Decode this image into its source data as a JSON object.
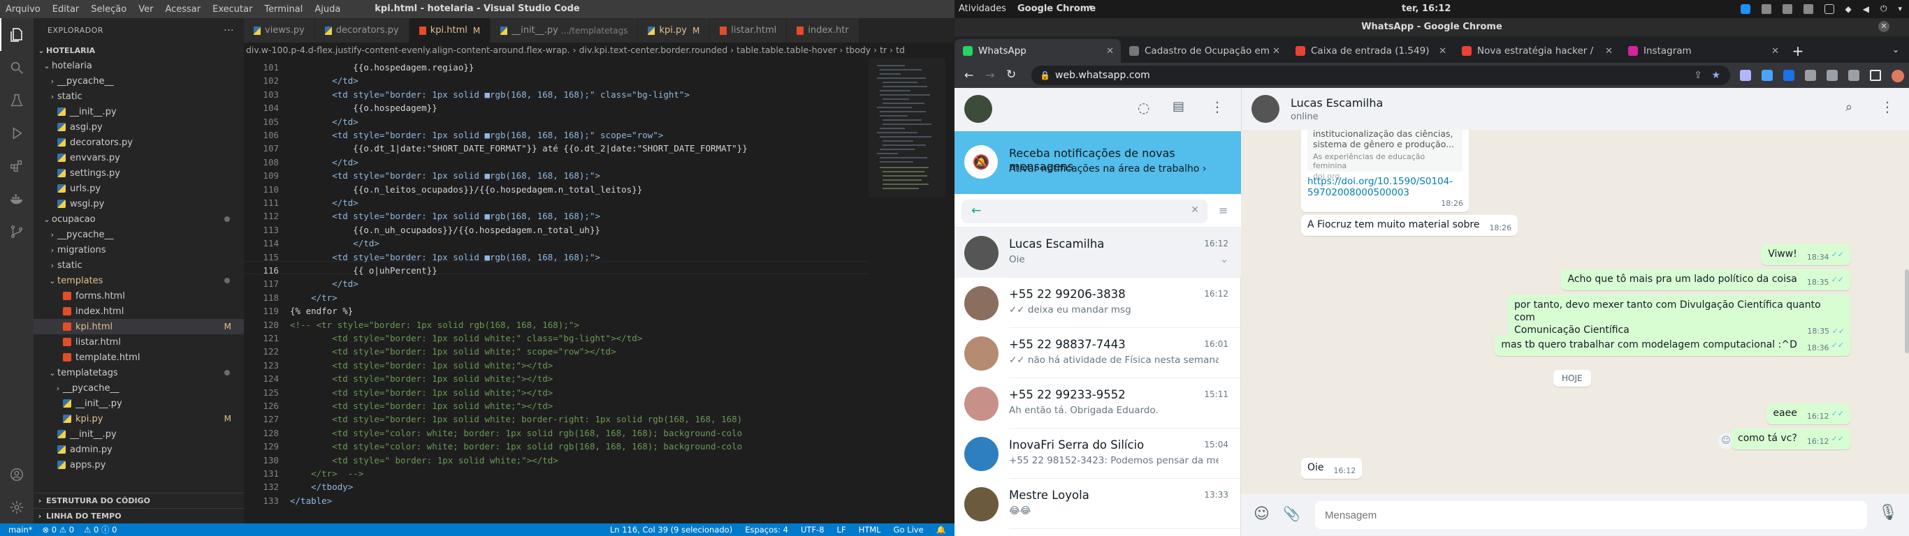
{
  "vscode": {
    "window_title": "kpi.html - hotelaria - Visual Studio Code",
    "menu": [
      "Arquivo",
      "Editar",
      "Seleção",
      "Ver",
      "Acessar",
      "Executar",
      "Terminal",
      "Ajuda"
    ],
    "explorer_title": "EXPLORADOR",
    "project": "HOTELARIA",
    "tree": [
      {
        "label": "hotelaria",
        "chev": "⌄",
        "kind": "folder",
        "indent": 1
      },
      {
        "label": "__pycache__",
        "chev": "›",
        "kind": "folder",
        "indent": 2
      },
      {
        "label": "static",
        "chev": "›",
        "kind": "folder",
        "indent": 2
      },
      {
        "label": "__init__.py",
        "kind": "py",
        "indent": 2
      },
      {
        "label": "asgi.py",
        "kind": "py",
        "indent": 2
      },
      {
        "label": "decorators.py",
        "kind": "py",
        "indent": 2
      },
      {
        "label": "envvars.py",
        "kind": "py",
        "indent": 2
      },
      {
        "label": "settings.py",
        "kind": "py",
        "indent": 2
      },
      {
        "label": "urls.py",
        "kind": "py",
        "indent": 2
      },
      {
        "label": "wsgi.py",
        "kind": "py",
        "indent": 2
      },
      {
        "label": "ocupacao",
        "chev": "⌄",
        "kind": "folder",
        "indent": 1,
        "dot": true
      },
      {
        "label": "__pycache__",
        "chev": "›",
        "kind": "folder",
        "indent": 2
      },
      {
        "label": "migrations",
        "chev": "›",
        "kind": "folder",
        "indent": 2
      },
      {
        "label": "static",
        "chev": "›",
        "kind": "folder",
        "indent": 2
      },
      {
        "label": "templates",
        "chev": "⌄",
        "kind": "folder",
        "indent": 2,
        "dot": true,
        "orange": true
      },
      {
        "label": "forms.html",
        "kind": "html",
        "indent": 3
      },
      {
        "label": "index.html",
        "kind": "html",
        "indent": 3
      },
      {
        "label": "kpi.html",
        "kind": "html",
        "indent": 3,
        "mark": "M",
        "selected": true
      },
      {
        "label": "listar.html",
        "kind": "html",
        "indent": 3
      },
      {
        "label": "template.html",
        "kind": "html",
        "indent": 3
      },
      {
        "label": "templatetags",
        "chev": "⌄",
        "kind": "folder",
        "indent": 2,
        "dot": true
      },
      {
        "label": "__pycache__",
        "chev": "›",
        "kind": "folder",
        "indent": 3
      },
      {
        "label": "__init__.py",
        "kind": "py",
        "indent": 3
      },
      {
        "label": "kpi.py",
        "kind": "py",
        "indent": 3,
        "mark": "M"
      },
      {
        "label": "__init__.py",
        "kind": "py",
        "indent": 2
      },
      {
        "label": "admin.py",
        "kind": "py",
        "indent": 2
      },
      {
        "label": "apps.py",
        "kind": "py",
        "indent": 2
      }
    ],
    "outline_title": "ESTRUTURA DO CÓDIGO",
    "timeline_title": "LINHA DO TEMPO",
    "tabs": [
      {
        "label": "views.py",
        "icon": "py"
      },
      {
        "label": "decorators.py",
        "icon": "py"
      },
      {
        "label": "kpi.html",
        "icon": "html",
        "mark": "M",
        "active": true
      },
      {
        "label": "__init__.py",
        "icon": "py",
        "dim": ".../templatetags"
      },
      {
        "label": "kpi.py",
        "icon": "py",
        "mark": "M"
      },
      {
        "label": "listar.html",
        "icon": "html"
      },
      {
        "label": "index.htr",
        "icon": "html"
      }
    ],
    "breadcrumb": "div.w-100.p-4.d-flex.justify-content-evenly.align-content-around.flex-wrap. › div.kpi.text-center.border.rounded › table.table.table-hover › tbody › tr › td",
    "line_numbers": [
      "101",
      "102",
      "103",
      "104",
      "105",
      "106",
      "107",
      "108",
      "109",
      "110",
      "111",
      "112",
      "113",
      "114",
      "115",
      "116",
      "117",
      "118",
      "119",
      "120",
      "121",
      "122",
      "123",
      "124",
      "125",
      "126",
      "127",
      "128",
      "129",
      "130",
      "131",
      "132",
      "133"
    ],
    "code_lines": [
      "            {{o.hospedagem.regiao}}",
      "        </td>",
      "        <td style=\"border: 1px solid ■rgb(168, 168, 168);\" class=\"bg-light\">",
      "            {{o.hospedagem}}",
      "        </td>",
      "        <td style=\"border: 1px solid ■rgb(168, 168, 168);\" scope=\"row\">",
      "            {{o.dt_1|date:\"SHORT_DATE_FORMAT\"}} até {{o.dt_2|date:\"SHORT_DATE_FORMAT\"}}",
      "        </td>",
      "        <td style=\"border: 1px solid ■rgb(168, 168, 168);\">",
      "            {{o.n_leitos_ocupados}}/{{o.hospedagem.n_total_leitos}}",
      "        </td>",
      "        <td style=\"border: 1px solid ■rgb(168, 168, 168);\">",
      "            {{o.n_uh_ocupados}}/{{o.hospedagem.n_total_uh}}",
      "            </td>",
      "        <td style=\"border: 1px solid ■rgb(168, 168, 168);\">",
      "            {{ o|uhPercent}}",
      "        </td>",
      "    </tr>",
      "{% endfor %}",
      "<!-- <tr style=\"border: 1px solid rgb(168, 168, 168);\">",
      "        <td style=\"border: 1px solid white;\" class=\"bg-light\"></td>",
      "        <td style=\"border: 1px solid white;\" scope=\"row\"></td>",
      "        <td style=\"border: 1px solid white;\"></td>",
      "        <td style=\"border: 1px solid white;\"></td>",
      "        <td style=\"border: 1px solid white;\"></td>",
      "        <td style=\"border: 1px solid white;\"></td>",
      "        <td style=\"border: 1px solid white; border-right: 1px solid rgb(168, 168, 168)",
      "        <td style=\"color: white; border: 1px solid rgb(168, 168, 168); background-colo",
      "        <td style=\"color: white; border: 1px solid rgb(168, 168, 168); background-colo",
      "        <td style=\" border: 1px solid white;\"></td>",
      "    </tr>  -->",
      "    </tbody>",
      "</table>"
    ],
    "current_line": 116,
    "status_left": [
      "main*",
      "⊗ 0 ⚠ 0",
      "⚠ 0 ⓘ 0"
    ],
    "status_right": [
      "Ln 116, Col 39 (9 selecionado)",
      "Espaços: 4",
      "UTF-8",
      "LF",
      "HTML",
      "Go Live",
      "🔔"
    ]
  },
  "gnome": {
    "activities": "Atividades",
    "app": "Google Chrome",
    "clock": "ter, 16:12"
  },
  "chrome": {
    "window_title": "WhatsApp - Google Chrome",
    "tabs": [
      {
        "label": "WhatsApp",
        "color": "#25d366",
        "active": true
      },
      {
        "label": "Cadastro de Ocupação em",
        "color": "#777777"
      },
      {
        "label": "Caixa de entrada (1.549)",
        "color": "#ea4335"
      },
      {
        "label": "Nova estratégia hacker /",
        "color": "#ea4335"
      },
      {
        "label": "Instagram",
        "color": "#d6249f"
      }
    ],
    "url": "web.whatsapp.com"
  },
  "whatsapp": {
    "notif_title": "Receba notificações de novas mensagens",
    "notif_sub": "Ativar notificações na área de trabalho ›",
    "chats": [
      {
        "name": "Lucas Escamilha",
        "preview": "Oie",
        "time": "16:12",
        "selected": true,
        "avatar": "#555555"
      },
      {
        "name": "+55 22 99206-3838",
        "preview": "✓✓ deixa eu mandar msg",
        "time": "16:12",
        "avatar": "#8a6e5e"
      },
      {
        "name": "+55 22 98837-7443",
        "preview": "✓✓ não há atividade de Física nesta semana, p...",
        "time": "16:01",
        "avatar": "#b58c72"
      },
      {
        "name": "+55 22 99233-9552",
        "preview": "Ah então tá.  Obrigada Eduardo.",
        "time": "15:11",
        "avatar": "#c7918a"
      },
      {
        "name": "InovaFri Serra do Silício",
        "preview": "+55 22 98152-3423: Podemos pensar da mes...",
        "time": "15:04",
        "avatar": "#2e7fbf"
      },
      {
        "name": "Mestre Loyola",
        "preview": "😂😂",
        "time": "13:33",
        "avatar": "#6b5a3e"
      }
    ],
    "contact": {
      "name": "Lucas Escamilha",
      "status": "online"
    },
    "link_preview": {
      "line1": "institucionalização das ciências,",
      "line2": "sistema de gênero e produção...",
      "desc": "As experiências de educação feminina",
      "domain": "doi.org"
    },
    "messages": [
      {
        "dir": "in",
        "text": "https://doi.org/10.1590/S0104-",
        "text2": "59702008000500003",
        "time": "18:26",
        "link": true
      },
      {
        "dir": "in",
        "text": "A Fiocruz tem muito material sobre",
        "time": "18:26"
      },
      {
        "dir": "out",
        "text": "Viww!",
        "time": "18:34"
      },
      {
        "dir": "out",
        "text": "Acho que tô mais pra um lado político da coisa",
        "time": "18:35"
      },
      {
        "dir": "out",
        "text": "por tanto, devo mexer tanto com Divulgação Científica quanto com",
        "text2": "Comunicação Científica",
        "time": "18:35"
      },
      {
        "dir": "out",
        "text": "mas tb quero trabalhar com modelagem computacional :^D",
        "time": "18:36"
      },
      {
        "dir": "day",
        "text": "HOJE"
      },
      {
        "dir": "out",
        "text": "eaee",
        "time": "16:12"
      },
      {
        "dir": "out",
        "text": "como tá vc?",
        "time": "16:12"
      },
      {
        "dir": "in",
        "text": "Oie",
        "time": "16:12"
      }
    ],
    "composer_placeholder": "Mensagem"
  }
}
